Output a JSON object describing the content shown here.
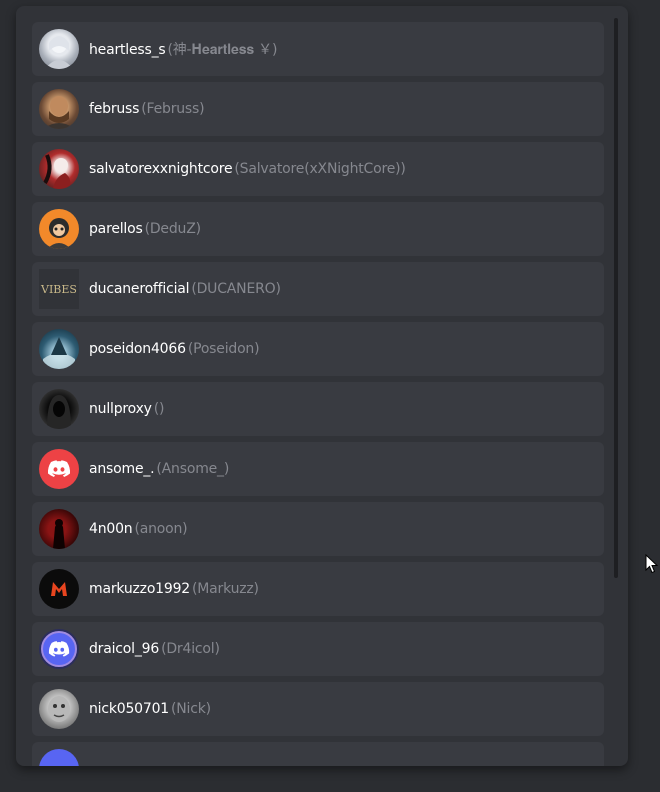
{
  "members": [
    {
      "username": "heartless_s",
      "display": "(神-𝐇𝐞𝐚𝐫𝐭𝐥𝐞𝐬𝐬 ￥)",
      "avatar": "heartless-avatar"
    },
    {
      "username": "februss",
      "display": "(Februss)",
      "avatar": "februss-avatar"
    },
    {
      "username": "salvatorexxnightcore",
      "display": "(Salvatore(xXNightCore))",
      "avatar": "salvatore-avatar"
    },
    {
      "username": "parellos",
      "display": "(DeduZ)",
      "avatar": "parellos-avatar"
    },
    {
      "username": "ducanerofficial",
      "display": "(DUCANERO)",
      "avatar": "ducanero-avatar",
      "avatar_text": "VIBES"
    },
    {
      "username": "poseidon4066",
      "display": "(Poseidon)",
      "avatar": "poseidon-avatar"
    },
    {
      "username": "nullproxy",
      "display": "()",
      "avatar": "nullproxy-avatar"
    },
    {
      "username": "ansome_.",
      "display": "(Ansome_)",
      "avatar": "discord-logo-avatar"
    },
    {
      "username": "4n00n",
      "display": "(anoon)",
      "avatar": "4n00n-avatar"
    },
    {
      "username": "markuzzo1992",
      "display": "(Markuzz)",
      "avatar": "markuzz-avatar"
    },
    {
      "username": "draicol_96",
      "display": "(Dr4icol)",
      "avatar": "discord-logo-avatar"
    },
    {
      "username": "nick050701",
      "display": "(Nick)",
      "avatar": "nick-avatar"
    },
    {
      "username": "",
      "display": "",
      "avatar": "partial-avatar"
    }
  ],
  "colors": {
    "page_bg": "#2b2d31",
    "panel_bg": "#313338",
    "row_bg": "#393b41",
    "username": "#ffffff",
    "display_name": "#86888f",
    "discord_red": "#ed4245",
    "discord_blurple": "#5865f2"
  }
}
